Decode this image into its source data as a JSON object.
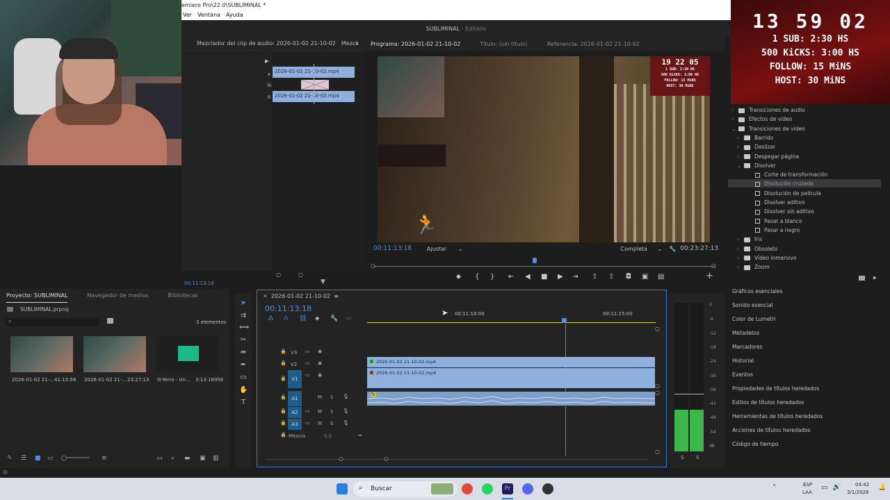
{
  "window": {
    "title": "emiere Pro\\22.0\\SUBLIMINAL *",
    "project_header": "SUBLIMINAL",
    "header_status": "Editado"
  },
  "menu": [
    "Ver",
    "Ventana",
    "Ayuda"
  ],
  "stream_overlay": {
    "clock": "13 59 02",
    "lines": [
      "1 SUB: 2:30 HS",
      "500 KiCKS: 3:00 HS",
      "FOLLOW: 15 MiNS",
      "HOST: 30 MiNS"
    ]
  },
  "source_panel": {
    "tabs": [
      "Mezclador del clip de audio: 2026-01-02 21-10-02",
      "Mezclı"
    ],
    "clip_a": "2026-01-02 21-10-02.mp4",
    "clip_b": "2026-01-02 21-10-02.mp4",
    "track_a": "A",
    "track_b": "B",
    "fx": "fx",
    "timecode": "00:11:13:18"
  },
  "program_monitor": {
    "tabs": [
      "Programa: 2026-01-02 21-10-02",
      "Título: (sin título)",
      "Referencia: 2026-01-02 21-10-02"
    ],
    "timecode": "00:11:13:18",
    "fit": "Ajustar",
    "resolution": "Completa",
    "duration": "00:23:27:13",
    "video_overlay": {
      "clock": "19 22 05",
      "lines": [
        "1 SUB: 2:30 HS",
        "500 KiCKS: 3:00 HS",
        "FOLLOW: 15 MiNS",
        "HOST: 30 MiNS"
      ]
    }
  },
  "effects_panel": {
    "rows": [
      {
        "label": "Transiciones de audio",
        "type": "folder",
        "level": 0,
        "open": false
      },
      {
        "label": "Efectos de vídeo",
        "type": "folder",
        "level": 0,
        "open": false
      },
      {
        "label": "Transiciones de vídeo",
        "type": "folder",
        "level": 0,
        "open": true
      },
      {
        "label": "Barrido",
        "type": "folder",
        "level": 1,
        "open": false
      },
      {
        "label": "Deslizar",
        "type": "folder",
        "level": 1,
        "open": false
      },
      {
        "label": "Despegar página",
        "type": "folder",
        "level": 1,
        "open": false
      },
      {
        "label": "Disolver",
        "type": "folder",
        "level": 1,
        "open": true
      },
      {
        "label": "Corte de transformación",
        "type": "effect",
        "level": 2
      },
      {
        "label": "Disolución cruzada",
        "type": "effect",
        "level": 2
      },
      {
        "label": "Disolución de película",
        "type": "effect",
        "level": 2
      },
      {
        "label": "Disolver aditivo",
        "type": "effect",
        "level": 2
      },
      {
        "label": "Disolver sin aditivo",
        "type": "effect",
        "level": 2
      },
      {
        "label": "Pasar a blanco",
        "type": "effect",
        "level": 2
      },
      {
        "label": "Pasar a negro",
        "type": "effect",
        "level": 2
      },
      {
        "label": "Iris",
        "type": "folder",
        "level": 1,
        "open": false
      },
      {
        "label": "Obsoleto",
        "type": "folder",
        "level": 1,
        "open": false
      },
      {
        "label": "Vídeo inmersivo",
        "type": "folder",
        "level": 1,
        "open": false
      },
      {
        "label": "Zoom",
        "type": "folder",
        "level": 1,
        "open": false
      }
    ],
    "selected": "Disolución cruzada"
  },
  "right_panels": [
    "Gráficos esenciales",
    "Sonido esencial",
    "Color de Lumetri",
    "Metadatos",
    "Marcadores",
    "Historial",
    "Eventos",
    "Propiedades de títulos heredados",
    "Estilos de títulos heredados",
    "Herramientas de títulos heredados",
    "Acciones de títulos heredados",
    "Código de tiempo"
  ],
  "project_panel": {
    "tabs": [
      "Proyecto: SUBLIMINAL",
      "Navegador de medios",
      "Bibliotecas"
    ],
    "file": "SUBLIMINAL.prproj",
    "count": "3 elementos",
    "items": [
      {
        "name": "2026-01-02 21-...",
        "duration": "41:15:56"
      },
      {
        "name": "2026-01-02 21-...",
        "duration": "23:27:13"
      },
      {
        "name": "G-Yerro - Un...",
        "duration": "3:13:16956"
      }
    ]
  },
  "timeline": {
    "tab": "2026-01-02 21-10-02",
    "timecode": "00:11:13:18",
    "ruler": [
      "00:11:10:00",
      "00:11:15:00"
    ],
    "tracks": {
      "v3": "V3",
      "v2": "V2",
      "v1": "V1",
      "v1_src": "V1",
      "a1": "A1",
      "a1_src": "A1",
      "a2": "A2",
      "a3": "A3",
      "mix": "Mezcla",
      "mix_value": "0,0",
      "m": "M",
      "s": "S"
    },
    "clips": {
      "v2": "2026-01-02 21-10-02.mp4",
      "v1": "2026-01-02 21-10-02.mp4",
      "a1_fx": "fx"
    }
  },
  "meters": {
    "scale": [
      "0",
      "-6",
      "-12",
      "-18",
      "-24",
      "-30",
      "-36",
      "-42",
      "-48",
      "-54",
      "dB"
    ],
    "solo": [
      "S",
      "S"
    ],
    "level_left": 0.28,
    "level_right": 0.28
  },
  "taskbar": {
    "search": "Buscar",
    "lang": "ESP",
    "lang2": "LAA",
    "time": "04:42",
    "date": "3/1/2026"
  }
}
